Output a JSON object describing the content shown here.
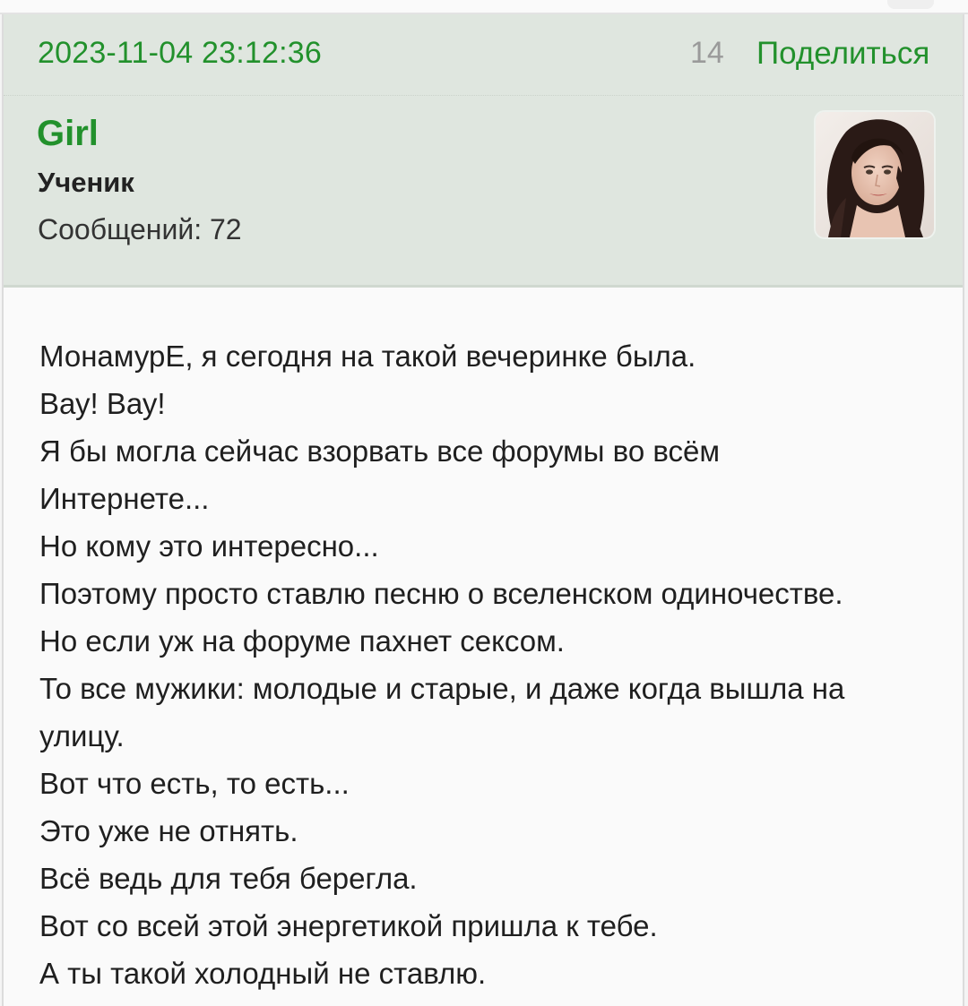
{
  "post": {
    "date": "2023-11-04 23:12:36",
    "number": "14",
    "share_label": "Поделиться"
  },
  "author": {
    "name": "Girl",
    "rank": "Ученик",
    "posts_label": "Сообщений: 72"
  },
  "message": {
    "lines": [
      "МонамурЕ, я сегодня на такой вечеринке была.",
      "Вау! Вау!",
      "Я бы могла сейчас взорвать все форумы во всём",
      "Интернете...",
      "Но кому это интересно...",
      "Поэтому просто ставлю песню о вселенском одиночестве.",
      "Но если уж на форуме пахнет сексом.",
      "То все мужики: молодые и старые, и даже когда вышла на",
      "улицу.",
      "Вот что есть, то есть...",
      "Это уже не отнять.",
      "Всё ведь для тебя берегла.",
      "Вот со всей этой энергетикой пришла к тебе.",
      "А ты такой холодный не ставлю."
    ]
  },
  "colors": {
    "accent_green": "#22912c",
    "header_bg": "#dfe6df",
    "body_bg": "#fafafa",
    "muted_text": "#9a9a9a"
  }
}
